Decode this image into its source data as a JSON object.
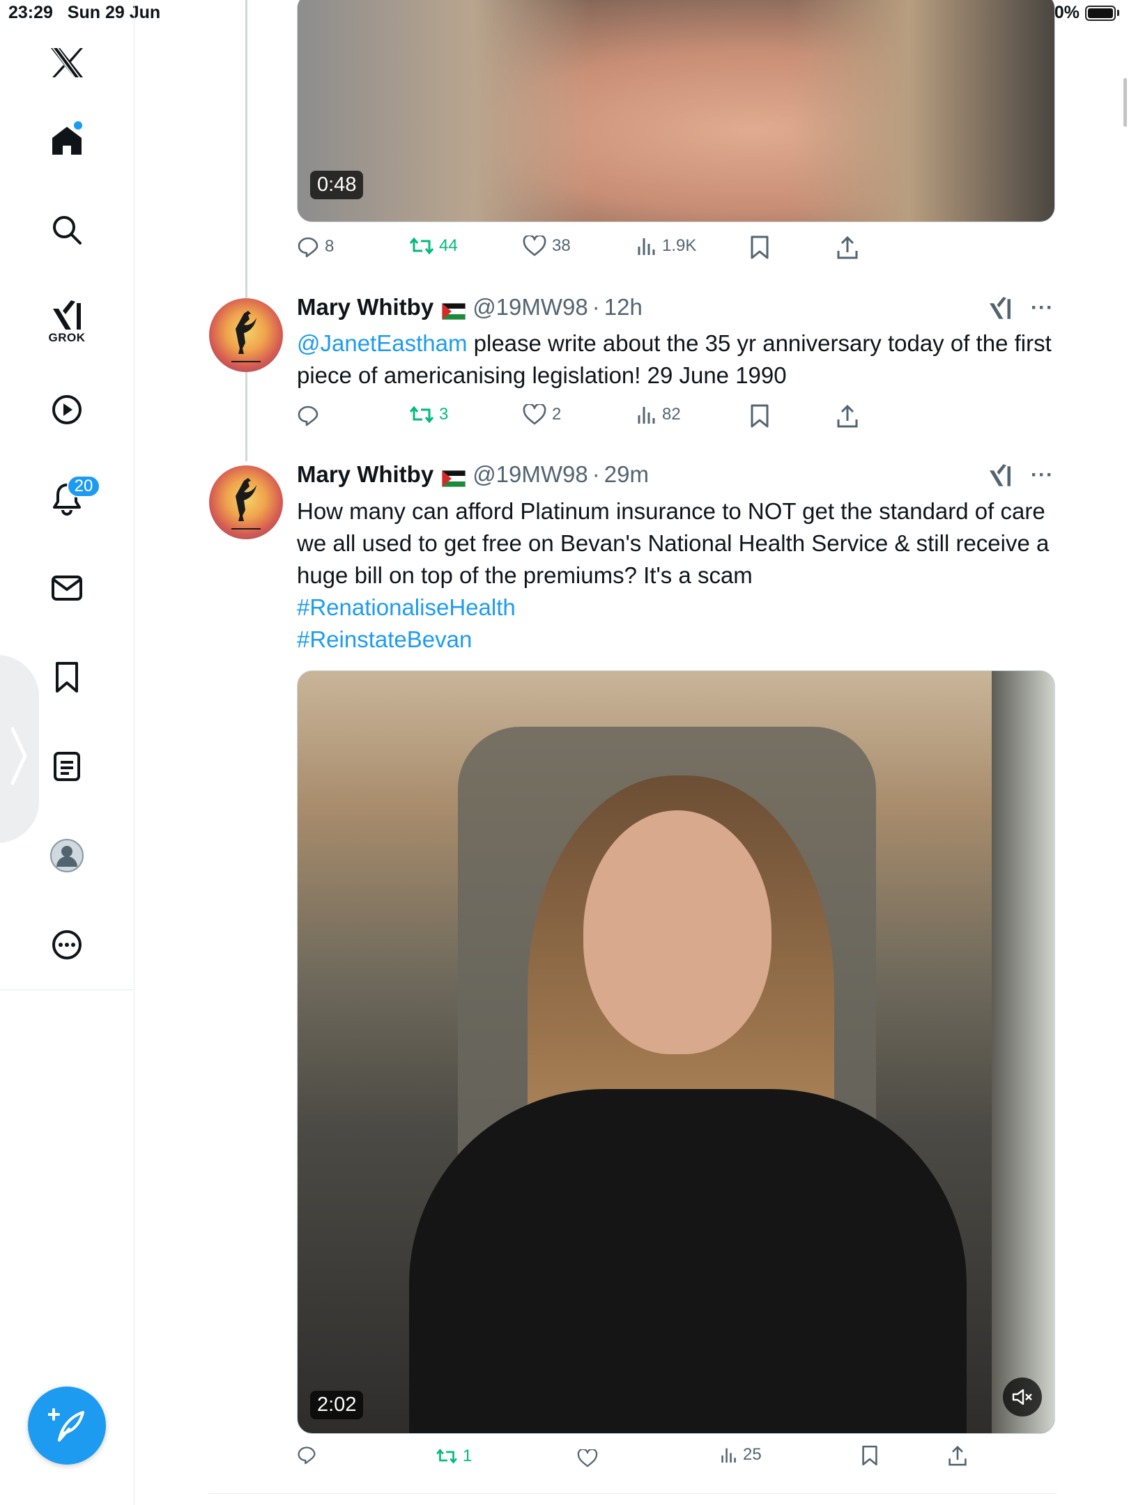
{
  "status_bar": {
    "time": "23:29",
    "date": "Sun 29 Jun",
    "battery": "100%"
  },
  "sidebar": {
    "items": [
      {
        "name": "x-logo",
        "icon": "x-logo-icon"
      },
      {
        "name": "home",
        "icon": "home-icon"
      },
      {
        "name": "explore",
        "icon": "search-icon"
      },
      {
        "name": "grok",
        "icon": "grok-icon",
        "label": "GROK"
      },
      {
        "name": "video",
        "icon": "play-icon"
      },
      {
        "name": "notifications",
        "icon": "bell-icon",
        "badge": "20"
      },
      {
        "name": "messages",
        "icon": "mail-icon"
      },
      {
        "name": "bookmarks",
        "icon": "bookmark-icon"
      },
      {
        "name": "lists",
        "icon": "list-icon"
      },
      {
        "name": "profile",
        "icon": "profile-icon"
      },
      {
        "name": "more",
        "icon": "more-icon"
      }
    ],
    "compose_icon": "compose-post-icon",
    "accent": "#1d9bf0"
  },
  "tweets": {
    "top": {
      "duration": "0:48",
      "actions": {
        "replies": "8",
        "reposts": "44",
        "likes": "38",
        "views": "1.9K"
      }
    },
    "reply1": {
      "name": "Mary Whitby",
      "handle": "@19MW98",
      "time": "12h",
      "mention": "@JanetEastham",
      "text": " please write about the 35 yr anniversary today of the first piece of americanising legislation! 29 June 1990",
      "actions": {
        "replies": "",
        "reposts": "3",
        "likes": "2",
        "views": "82"
      }
    },
    "reply2": {
      "name": "Mary Whitby",
      "handle": "@19MW98",
      "time": "29m",
      "text": "How many can afford Platinum insurance to NOT get the standard of care we all used to get free on Bevan's National Health Service & still receive a huge bill on top of the premiums? It's a scam",
      "hashtag1": "#RenationaliseHealth",
      "hashtag2": "#ReinstateBevan",
      "duration": "2:02",
      "actions": {
        "replies": "",
        "reposts": "1",
        "likes": "",
        "views": "25"
      }
    }
  },
  "colors": {
    "link": "#1d9bf0",
    "repost_active": "#00ba7c",
    "secondary_text": "#536471"
  }
}
